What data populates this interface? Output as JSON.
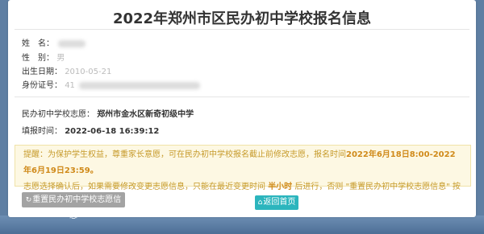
{
  "page_title": "2022年郑州市区民办初中学校报名信息",
  "fields": {
    "name_label": "姓　名：",
    "gender_label": "性　别：",
    "gender_value": "男",
    "birth_label": "出生日期：",
    "birth_value": "2010-05-21",
    "id_label": "身份证号：",
    "id_value": "41"
  },
  "choice_label": "民办初中学校志愿：",
  "choice_value": "郑州市金水区新奇初级中学",
  "fill_time_label": "填报时间：",
  "fill_time_value": "2022-06-18 16:39:12",
  "notice": {
    "part1": "提醒：为保护学生权益，尊重家长意愿，可在民办初中学校报名截止前修改志愿，报名时间",
    "time_range": "2022年6月18日8:00-2022年6月19日23:59。",
    "part2": "志愿选择确认后，如果需要修改变更志愿信息，只能在最近变更时间",
    "half_hour": "半小时",
    "part3": "后进行，否则 \"重置民办初中学校志愿信息\" 按钮不能使用。"
  },
  "buttons": {
    "reset_icon": "↻",
    "reset_label": "重置民办初中学校志愿信息",
    "home_icon": "⌂",
    "home_label": "返回首页"
  }
}
